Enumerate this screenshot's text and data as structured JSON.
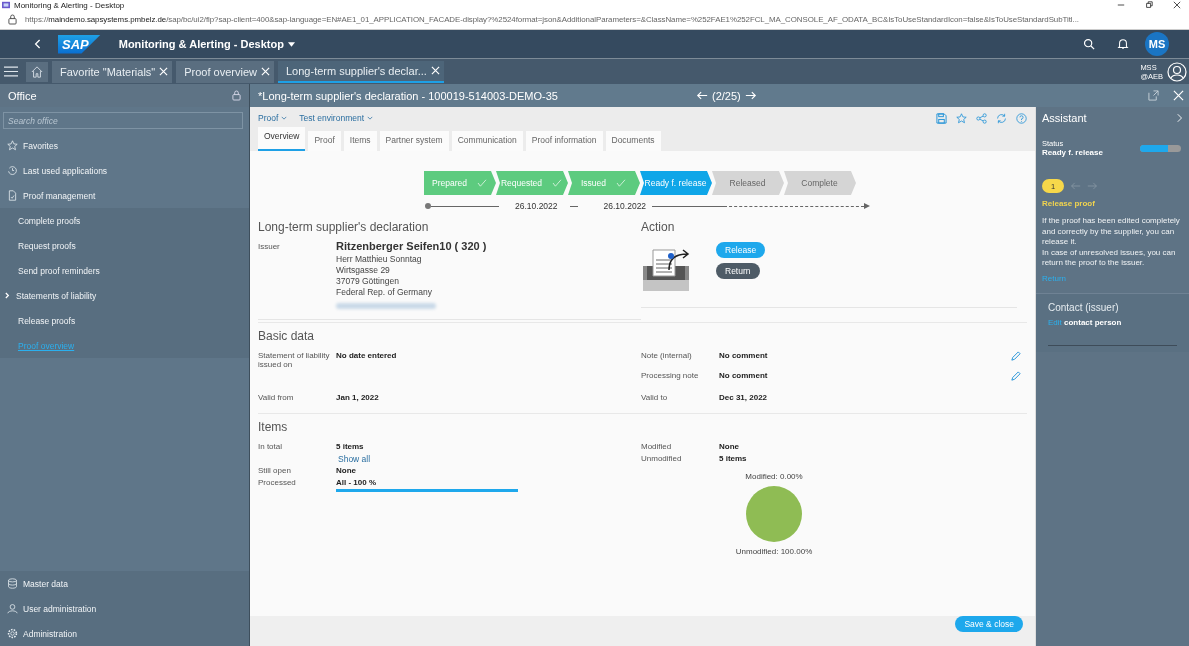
{
  "browser": {
    "title": "Monitoring & Alerting - Desktop",
    "url_host": "maindemo.sapsystems.pmbelz.de",
    "url_prefix": "https://",
    "url_rest": "/sap/bc/ui2/flp?sap-client=400&sap-language=EN#AE1_01_APPLICATION_FACADE-display?%2524format=json&AdditionalParameters=&ClassName=%252FAE1%252FCL_MA_CONSOLE_AF_ODATA_BC&IsToUseStandardIcon=false&IsToUseStandardSubTitl..."
  },
  "shell": {
    "logo": "SAP",
    "title": "Monitoring & Alerting - Desktop",
    "avatar": "MS"
  },
  "app_tabs": [
    {
      "label": "Favorite \"Materials\"",
      "selected": false
    },
    {
      "label": "Proof overview",
      "selected": false
    },
    {
      "label": "Long-term supplier's declar...",
      "selected": true
    }
  ],
  "user": {
    "line1": "MSS",
    "line2": "@AEB"
  },
  "sidebar": {
    "title": "Office",
    "search_placeholder": "Search office",
    "items": [
      {
        "label": "Favorites",
        "kind": "star",
        "selected": false
      },
      {
        "label": "Last used applications",
        "kind": "history",
        "selected": false
      },
      {
        "label": "Proof management",
        "kind": "document",
        "selected": false,
        "children": [
          {
            "label": "Complete proofs",
            "selected": false
          },
          {
            "label": "Request proofs",
            "selected": false
          },
          {
            "label": "Send proof reminders",
            "selected": false
          },
          {
            "label": "Statements of liability",
            "selected": false,
            "expandable": true
          },
          {
            "label": "Release proofs",
            "selected": false
          },
          {
            "label": "Proof overview",
            "selected": true
          }
        ]
      }
    ],
    "bottom_items": [
      {
        "label": "Master data",
        "kind": "database"
      },
      {
        "label": "User administration",
        "kind": "user"
      },
      {
        "label": "Administration",
        "kind": "gear"
      }
    ]
  },
  "document": {
    "title": "*Long-term supplier's declaration - 100019-514003-DEMO-35",
    "pager": "(2/25)",
    "menus": [
      "Proof",
      "Test environment"
    ],
    "tabs": [
      {
        "label": "Overview",
        "selected": true
      },
      {
        "label": "Proof",
        "selected": false
      },
      {
        "label": "Items",
        "selected": false
      },
      {
        "label": "Partner system",
        "selected": false
      },
      {
        "label": "Communication",
        "selected": false
      },
      {
        "label": "Proof information",
        "selected": false
      },
      {
        "label": "Documents",
        "selected": false
      }
    ],
    "steps": [
      {
        "label": "Prepared",
        "kind": "done"
      },
      {
        "label": "Requested",
        "kind": "done"
      },
      {
        "label": "Issued",
        "kind": "done"
      },
      {
        "label": "Ready f. release",
        "kind": "active"
      },
      {
        "label": "Released",
        "kind": "pending"
      },
      {
        "label": "Complete",
        "kind": "pending"
      }
    ],
    "step_dates": [
      "26.10.2022",
      "26.10.2022"
    ],
    "declaration": {
      "title": "Long-term supplier's declaration",
      "issuer_label": "Issuer",
      "issuer_name": "Ritzenberger Seifen10 ( 320 )",
      "address": [
        "Herr Matthieu Sonntag",
        "Wirtsgasse 29",
        "37079 Göttingen",
        "Federal Rep. of Germany"
      ]
    },
    "action": {
      "title": "Action",
      "buttons": [
        {
          "label": "Release",
          "kind": "primary"
        },
        {
          "label": "Return",
          "kind": "secondary"
        }
      ]
    },
    "basic_data": {
      "title": "Basic data",
      "left": [
        {
          "label": "Statement of liability issued on",
          "value": "No date entered"
        },
        {
          "label": "Valid from",
          "value": "Jan 1, 2022"
        }
      ],
      "right": [
        {
          "label": "Note (internal)",
          "value": "No comment",
          "editable": true
        },
        {
          "label": "Processing note",
          "value": "No comment",
          "editable": true
        },
        {
          "label": "Valid to",
          "value": "Dec 31, 2022",
          "editable": false
        }
      ]
    },
    "items": {
      "title": "Items",
      "total_label": "In total",
      "total_value": "5 items",
      "show_all": "Show all",
      "open_label": "Still open",
      "open_value": "None",
      "processed_label": "Processed",
      "processed_value": "All - 100 %",
      "level": 1,
      "modified_label": "Modified",
      "modified_value": "None",
      "unmodified_label": "Unmodified",
      "unmodified_value": "5 items",
      "chart_data": {
        "type": "pie",
        "series": [
          {
            "color": "#8fbc54",
            "values": [
              0,
              100
            ]
          }
        ],
        "value_labels": [
          "Modified: 0.00%",
          "Unmodified: 100.00%"
        ]
      }
    },
    "footer_button": "Save & close"
  },
  "assistant": {
    "title": "Assistant",
    "status_label": "Status",
    "status_value": "Ready f. release",
    "level": 0.68,
    "step": "1",
    "step_title": "Release proof",
    "text": [
      "If the proof has been edited completely and correctly by the supplier, you can release it.",
      "In case of unresolved issues, you can return the proof to the issuer."
    ],
    "link": "Return",
    "contact_title": "Contact (issuer)",
    "contact_link": "Edit",
    "contact_text": "contact person"
  }
}
